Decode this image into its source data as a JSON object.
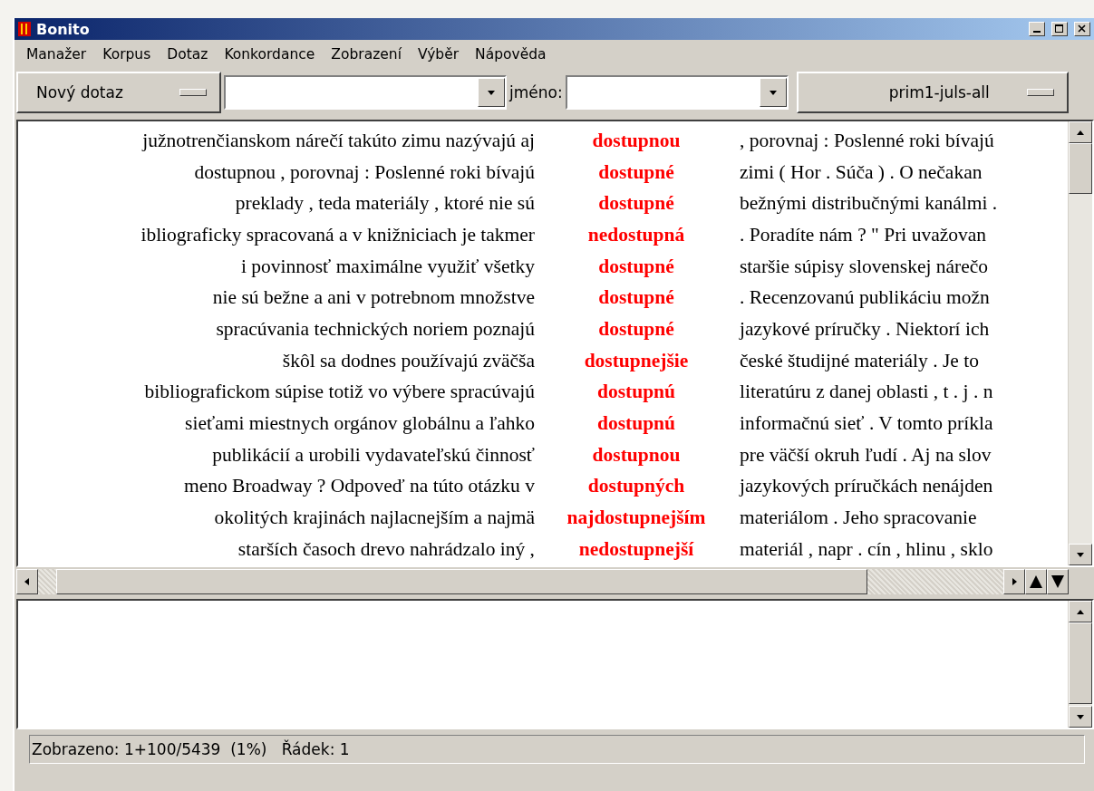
{
  "window": {
    "title": "Bonito"
  },
  "menu": [
    "Manažer",
    "Korpus",
    "Dotaz",
    "Konkordance",
    "Zobrazení",
    "Výběr",
    "Nápověda"
  ],
  "toolbar": {
    "query_button": "Nový dotaz",
    "name_label": "jméno:",
    "corpus_button": "prim1-juls-all"
  },
  "concordance": [
    {
      "left": "južnotrenčianskom nárečí takúto zimu nazývajú aj",
      "kwic": "dostupnou",
      "right": ", porovnaj : Poslenné roki bívajú"
    },
    {
      "left": "dostupnou , porovnaj : Poslenné roki bívajú",
      "kwic": "dostupné",
      "right": "zimi ( Hor . Súča ) . O nečakan"
    },
    {
      "left": "preklady , teda materiály , ktoré nie sú",
      "kwic": "dostupné",
      "right": "bežnými distribučnými kanálmi ."
    },
    {
      "left": "ibliograficky spracovaná a v knižniciach je takmer",
      "kwic": "nedostupná",
      "right": ". Poradíte nám ? \" Pri uvažovan"
    },
    {
      "left": "i povinnosť maximálne využiť všetky",
      "kwic": "dostupné",
      "right": "staršie súpisy slovenskej nárečo"
    },
    {
      "left": "nie sú bežne a ani v potrebnom množstve",
      "kwic": "dostupné",
      "right": ". Recenzovanú publikáciu možn"
    },
    {
      "left": "spracúvania technických noriem poznajú",
      "kwic": "dostupné",
      "right": "jazykové príručky . Niektorí ich"
    },
    {
      "left": "škôl sa dodnes používajú zväčša",
      "kwic": "dostupnejšie",
      "right": "české študijné materiály . Je to"
    },
    {
      "left": "bibliografickom súpise totiž vo výbere spracúvajú",
      "kwic": "dostupnú",
      "right": "literatúru z danej oblasti , t . j . n"
    },
    {
      "left": "sieťami miestnych orgánov globálnu a ľahko",
      "kwic": "dostupnú",
      "right": "informačnú sieť . V tomto príkla"
    },
    {
      "left": "publikácií a urobili vydavateľskú činnosť",
      "kwic": "dostupnou",
      "right": "pre väčší okruh ľudí . Aj na slov"
    },
    {
      "left": "meno Broadway ? Odpoveď na túto otázku v",
      "kwic": "dostupných",
      "right": "jazykových príručkách nenájden"
    },
    {
      "left": "okolitých krajinách najlacnejším a najmä",
      "kwic": "najdostupnejším",
      "right": "materiálom . Jeho spracovanie"
    },
    {
      "left": "starších časoch drevo nahrádzalo iný ,",
      "kwic": "nedostupnejší",
      "right": "materiál , napr . cín , hlinu , sklo"
    }
  ],
  "status_bar": "Zobrazeno: 1+100/5439  (1%)   Řádek: 1"
}
